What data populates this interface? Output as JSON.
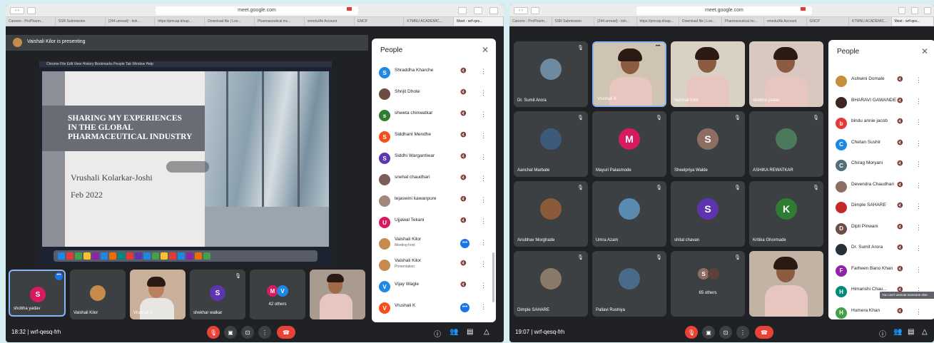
{
  "browser": {
    "url": "meet.google.com",
    "tabs": [
      "Careers - ProPharm...",
      "SSR Submission",
      "(244 unread) - tish...",
      "https://pmcap.it/sap...",
      "Download file | Lov...",
      "Pharmaceutical inc...",
      "vmedu/Ak Account",
      "GNCP",
      "KTMNU ACADEMIC...",
      "Meet - wrf-qes..."
    ]
  },
  "left": {
    "presenting": "Vaishali Kilor is presenting",
    "slide": {
      "l1": "SHARING MY EXPERIENCES",
      "l2": "IN THE GLOBAL",
      "l3": "PHARMACEUTICAL INDUSTRY",
      "author": "Vrushali Kolarkar-Joshi",
      "date": "Feb 2022"
    },
    "panel_title": "People",
    "people": [
      {
        "name": "Shraddha Kharche",
        "initial": "S",
        "color": "#1e88e5"
      },
      {
        "name": "Shrijit Dhote",
        "initial": "",
        "color": "#6d4c41"
      },
      {
        "name": "shweta chinwatkar",
        "initial": "s",
        "color": "#2e7d32"
      },
      {
        "name": "Siddhant Mendhe",
        "initial": "S",
        "color": "#f4511e"
      },
      {
        "name": "Siddhi Wargantiwar",
        "initial": "S",
        "color": "#5e35b1"
      },
      {
        "name": "snehal chaudhari",
        "initial": "",
        "color": "#7b5e57"
      },
      {
        "name": "tejaswini kawanpure",
        "initial": "",
        "color": "#a1887f"
      },
      {
        "name": "Ujjawal Tekani",
        "initial": "U",
        "color": "#d81b60"
      },
      {
        "name": "Vaishali Kilor",
        "sub": "Meeting host",
        "initial": "",
        "color": "#c68a4c"
      },
      {
        "name": "Vaishali Kilor",
        "sub": "Presentation",
        "initial": "",
        "color": "#c68a4c"
      },
      {
        "name": "Vijay Wagle",
        "initial": "V",
        "color": "#1e88e5"
      },
      {
        "name": "Vrushali K",
        "initial": "V",
        "color": "#f4511e"
      }
    ],
    "tiles": [
      {
        "name": "shobha yadav",
        "initial": "S"
      },
      {
        "name": "Vaishali Kilor"
      },
      {
        "name": "Vrushali K"
      },
      {
        "name": "shekhar walkar",
        "initial": "S"
      },
      {
        "name": "42 others",
        "i1": "M",
        "i2": "V"
      },
      {
        "name": ""
      }
    ],
    "time": "18:32",
    "code": "wrf-qesq-frh"
  },
  "right": {
    "panel_title": "People",
    "people": [
      {
        "name": "Ashwini Domale",
        "initial": "",
        "color": "#c48f3d"
      },
      {
        "name": "BHARAVI GAWANDE",
        "initial": "",
        "color": "#3e2723"
      },
      {
        "name": "bindu annie jacob",
        "initial": "b",
        "color": "#e53935"
      },
      {
        "name": "Chetan Sushir",
        "initial": "C",
        "color": "#1e88e5"
      },
      {
        "name": "Chirag Moryani",
        "initial": "C",
        "color": "#546e7a"
      },
      {
        "name": "Devendra Chaudhari",
        "initial": "",
        "color": "#8d6e63"
      },
      {
        "name": "Dimple SAHARE",
        "initial": "",
        "color": "#c62828"
      },
      {
        "name": "Dipti Pinwani",
        "initial": "D",
        "color": "#6d4c41"
      },
      {
        "name": "Dr. Sumit Arora",
        "initial": "",
        "color": "#263238"
      },
      {
        "name": "Farheen Bano Khan",
        "initial": "F",
        "color": "#8e24aa"
      },
      {
        "name": "Himanshi Chau...",
        "initial": "H",
        "color": "#00897b"
      },
      {
        "name": "Humera Khan",
        "initial": "H",
        "color": "#43a047"
      }
    ],
    "tooltip": "You can't unmute someone else",
    "grid": [
      {
        "name": "Dr. Sumit Arora"
      },
      {
        "name": "Vrushali K"
      },
      {
        "name": "Vaishali Kilor"
      },
      {
        "name": "shobha yadav"
      },
      {
        "name": "Aanchal Marbate"
      },
      {
        "name": "Mayuri Palasmode",
        "initial": "M",
        "color": "#d81b60"
      },
      {
        "name": "Sheelpriya Walde",
        "initial": "S",
        "color": "#8d6e63"
      },
      {
        "name": "ASHIKA REWATKAR"
      },
      {
        "name": "Anubhav Morghade"
      },
      {
        "name": "Umra Azam"
      },
      {
        "name": "shital chavan",
        "initial": "S",
        "color": "#5e35b1"
      },
      {
        "name": "Kritika Ghormade",
        "initial": "K",
        "color": "#2e7d32"
      },
      {
        "name": "Dimple SAHARE"
      },
      {
        "name": "Pallavi Rushiya"
      },
      {
        "name": "65 others",
        "i1": "S"
      },
      {
        "name": ""
      }
    ],
    "time": "19:07",
    "code": "wrf-qesq-frh"
  }
}
